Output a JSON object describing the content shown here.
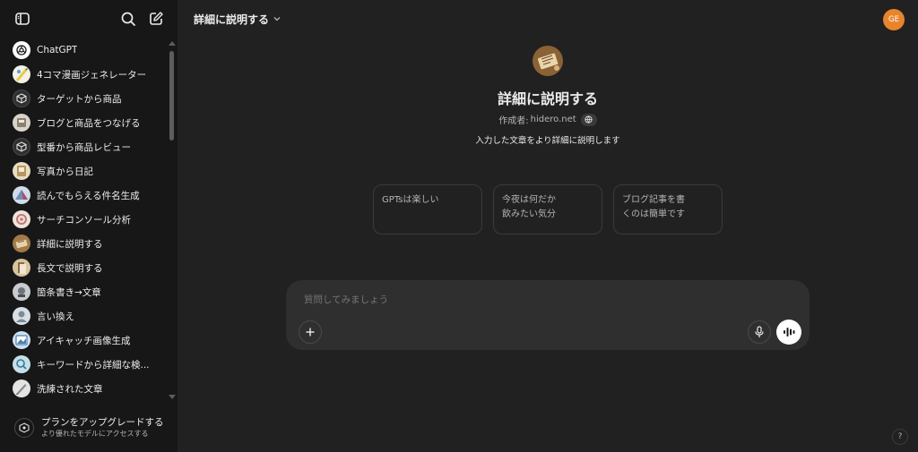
{
  "sidebar": {
    "items": [
      {
        "label": "ChatGPT",
        "icon": "openai-logo-icon",
        "color": "#ffffff"
      },
      {
        "label": "4コマ漫画ジェネレーター",
        "icon": "comic-generator-icon",
        "color": "#e6c845"
      },
      {
        "label": "ターゲットから商品",
        "icon": "cube-icon",
        "color": "#3a3a3a"
      },
      {
        "label": "ブログと商品をつなげる",
        "icon": "blog-product-icon",
        "color": "#c9c2b8"
      },
      {
        "label": "型番から商品レビュー",
        "icon": "cube-icon",
        "color": "#3a3a3a"
      },
      {
        "label": "写真から日記",
        "icon": "photo-diary-icon",
        "color": "#d8c6a4"
      },
      {
        "label": "読んでもらえる件名生成",
        "icon": "subject-generator-icon",
        "color": "#6a8fb8"
      },
      {
        "label": "サーチコンソール分析",
        "icon": "search-console-icon",
        "color": "#e8d7c9"
      },
      {
        "label": "詳細に説明する",
        "icon": "explain-detail-icon",
        "color": "#a07a4a"
      },
      {
        "label": "長文で説明する",
        "icon": "long-text-icon",
        "color": "#8b6b45"
      },
      {
        "label": "箇条書き→文章",
        "icon": "bullets-to-text-icon",
        "color": "#9aa0a6"
      },
      {
        "label": "言い換え",
        "icon": "paraphrase-icon",
        "color": "#b8c4cc"
      },
      {
        "label": "アイキャッチ画像生成",
        "icon": "eyecatch-image-icon",
        "color": "#4d7fb0"
      },
      {
        "label": "キーワードから詳細な検...",
        "icon": "keyword-search-icon",
        "color": "#7fb0c8"
      },
      {
        "label": "洗練された文章",
        "icon": "refined-text-icon",
        "color": "#c8c8c8"
      }
    ],
    "upgrade": {
      "title": "プランをアップグレードする",
      "subtitle": "より優れたモデルにアクセスする"
    }
  },
  "header": {
    "model_name": "詳細に説明する",
    "avatar_initials": "GE",
    "avatar_color": "#e8842c"
  },
  "gpt": {
    "title": "詳細に説明する",
    "creator_prefix": "作成者:",
    "creator": "hidero.net",
    "description": "入力した文章をより詳細に説明します"
  },
  "suggestions": [
    {
      "line1": "GPTsは楽しい",
      "line2": ""
    },
    {
      "line1": "今夜は何だか",
      "line2": "飲みたい気分"
    },
    {
      "line1": "ブログ記事を書",
      "line2": "くのは簡単です"
    }
  ],
  "composer": {
    "placeholder": "質問してみましょう"
  },
  "help": {
    "label": "?"
  }
}
